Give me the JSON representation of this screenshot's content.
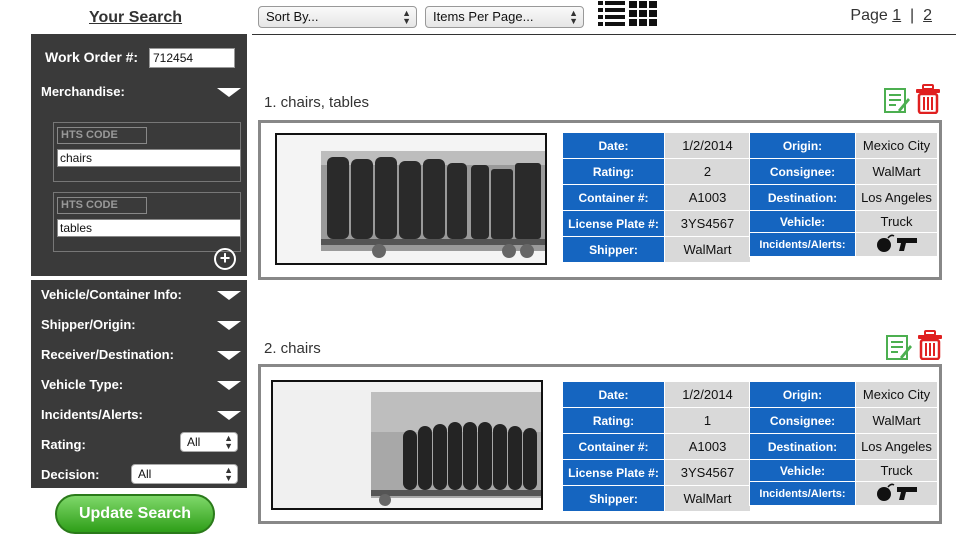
{
  "sidebar": {
    "title": "Your Search",
    "work_order_label": "Work Order #:",
    "work_order_value": "712454",
    "merchandise_label": "Merchandise:",
    "hts_entries": [
      {
        "code_placeholder": "HTS CODE",
        "value": "chairs"
      },
      {
        "code_placeholder": "HTS CODE",
        "value": "tables"
      }
    ],
    "filters": {
      "vehicle_container": "Vehicle/Container Info:",
      "shipper_origin": "Shipper/Origin:",
      "receiver_destination": "Receiver/Destination:",
      "vehicle_type": "Vehicle Type:",
      "incidents_alerts": "Incidents/Alerts:",
      "rating": "Rating:",
      "decision": "Decision:"
    },
    "rating_value": "All",
    "decision_value": "All",
    "update_button": "Update Search"
  },
  "toolbar": {
    "sort_by": "Sort By...",
    "items_per_page": "Items Per Page...",
    "page_label": "Page",
    "pages": [
      "1",
      "2"
    ],
    "separator": "|"
  },
  "labels": {
    "date": "Date:",
    "rating": "Rating:",
    "container": "Container #:",
    "license": "License Plate #:",
    "shipper": "Shipper:",
    "origin": "Origin:",
    "consignee": "Consignee:",
    "destination": "Destination:",
    "vehicle": "Vehicle:",
    "incidents": "Incidents/Alerts:"
  },
  "results": [
    {
      "title": "1. chairs, tables",
      "date": "1/2/2014",
      "rating": "2",
      "container": "A1003",
      "license": "3YS4567",
      "shipper": "WalMart",
      "origin": "Mexico City",
      "consignee": "WalMart",
      "destination": "Los Angeles",
      "vehicle": "Truck",
      "incident_icons": [
        "bomb-icon",
        "gun-icon"
      ]
    },
    {
      "title": "2. chairs",
      "date": "1/2/2014",
      "rating": "1",
      "container": "A1003",
      "license": "3YS4567",
      "shipper": "WalMart",
      "origin": "Mexico City",
      "consignee": "WalMart",
      "destination": "Los Angeles",
      "vehicle": "Truck",
      "incident_icons": [
        "bomb-icon",
        "gun-icon"
      ]
    }
  ],
  "colors": {
    "header_blue": "#1565c0",
    "panel_dark": "#3a3a3a",
    "button_green": "#2e9e18",
    "delete_red": "#e02020",
    "edit_green": "#4caf50"
  }
}
